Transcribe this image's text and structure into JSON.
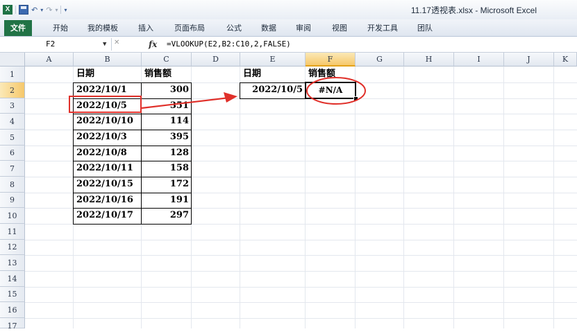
{
  "window": {
    "title": "11.17透视表.xlsx - Microsoft Excel",
    "app_icon_label": "X"
  },
  "quick_access": {
    "undo_glyph": "↶",
    "redo_glyph": "↷",
    "customize_glyph": "▾"
  },
  "ribbon": {
    "tabs": [
      "文件",
      "开始",
      "我的模板",
      "插入",
      "页面布局",
      "公式",
      "数据",
      "审阅",
      "视图",
      "开发工具",
      "团队"
    ]
  },
  "formula_bar": {
    "name_box": "F2",
    "name_box_dropdown": "▼",
    "cancel_glyph": "✕",
    "fx_label": "fx",
    "formula": "=VLOOKUP(E2,B2:C10,2,FALSE)"
  },
  "columns": [
    "A",
    "B",
    "C",
    "D",
    "E",
    "F",
    "G",
    "H",
    "I",
    "J",
    "K"
  ],
  "selected_column": "F",
  "rows": [
    "1",
    "2",
    "3",
    "4",
    "5",
    "6",
    "7",
    "8",
    "9",
    "10",
    "11",
    "12",
    "13",
    "14",
    "15",
    "16",
    "17"
  ],
  "selected_row": "2",
  "source_table": {
    "header_date": "日期",
    "header_sales": "销售额",
    "rows": [
      {
        "date": "2022/10/1",
        "sales": "300"
      },
      {
        "date": "2022/10/5",
        "sales": "351"
      },
      {
        "date": "2022/10/10",
        "sales": "114"
      },
      {
        "date": "2022/10/3",
        "sales": "395"
      },
      {
        "date": "2022/10/8",
        "sales": "128"
      },
      {
        "date": "2022/10/11",
        "sales": "158"
      },
      {
        "date": "2022/10/15",
        "sales": "172"
      },
      {
        "date": "2022/10/16",
        "sales": "191"
      },
      {
        "date": "2022/10/17",
        "sales": "297"
      }
    ]
  },
  "lookup_table": {
    "header_date": "日期",
    "header_sales": "销售额",
    "lookup_date": "2022/10/5",
    "result": "#N/A"
  },
  "annotation_colors": {
    "highlight": "#e0302a"
  }
}
